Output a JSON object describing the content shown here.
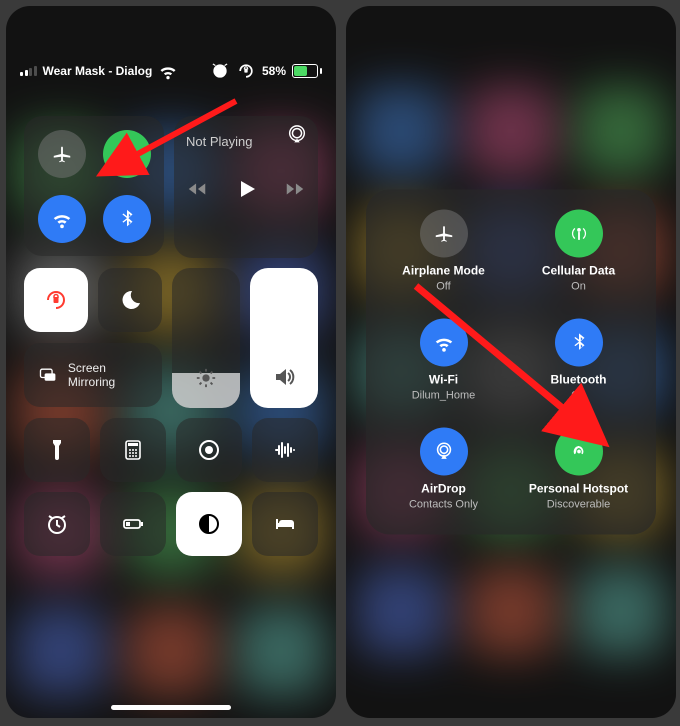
{
  "status": {
    "carrier": "Wear Mask - Dialog",
    "battery_pct": "58%"
  },
  "tiles": {
    "media_title": "Not Playing",
    "screen_mirroring": "Screen Mirroring"
  },
  "expanded": {
    "airplane": {
      "label": "Airplane Mode",
      "sub": "Off"
    },
    "cellular": {
      "label": "Cellular Data",
      "sub": "On"
    },
    "wifi": {
      "label": "Wi-Fi",
      "sub": "Dilum_Home"
    },
    "bluetooth": {
      "label": "Bluetooth",
      "sub": "On"
    },
    "airdrop": {
      "label": "AirDrop",
      "sub": "Contacts Only"
    },
    "hotspot": {
      "label": "Personal Hotspot",
      "sub": "Discoverable"
    }
  }
}
